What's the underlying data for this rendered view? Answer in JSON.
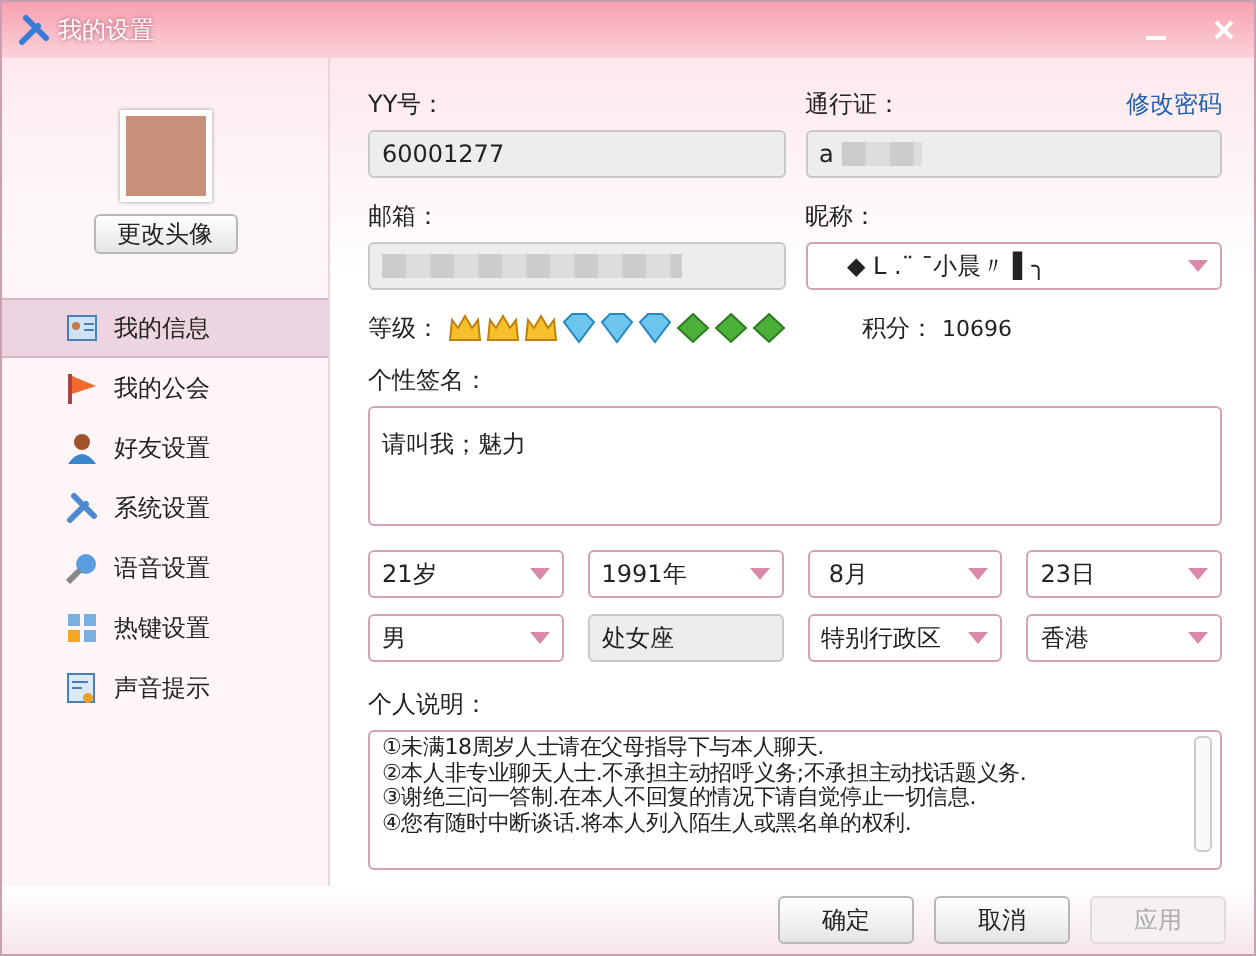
{
  "window": {
    "title": "我的设置"
  },
  "sidebar": {
    "change_avatar_button": "更改头像",
    "items": [
      {
        "label": "我的信息",
        "selected": true
      },
      {
        "label": "我的公会",
        "selected": false
      },
      {
        "label": "好友设置",
        "selected": false
      },
      {
        "label": "系统设置",
        "selected": false
      },
      {
        "label": "语音设置",
        "selected": false
      },
      {
        "label": "热键设置",
        "selected": false
      },
      {
        "label": "声音提示",
        "selected": false
      }
    ]
  },
  "account": {
    "yy_label": "YY号：",
    "yy_value": "60001277",
    "pass_label": "通行证：",
    "change_password_link": "修改密码",
    "pass_value": "a",
    "email_label": "邮箱：",
    "nickname_label": "昵称：",
    "nickname_value": "◆ L .¨ ¯小晨〃 ▌╮"
  },
  "level": {
    "label": "等级：",
    "badges": [
      {
        "kind": "crown"
      },
      {
        "kind": "crown"
      },
      {
        "kind": "crown"
      },
      {
        "kind": "diamond"
      },
      {
        "kind": "diamond"
      },
      {
        "kind": "diamond"
      },
      {
        "kind": "leaf"
      },
      {
        "kind": "leaf"
      },
      {
        "kind": "leaf"
      }
    ],
    "points_label": "积分：",
    "points_value": "10696"
  },
  "signature": {
    "label": "个性签名：",
    "value": "请叫我；魅力"
  },
  "profile_fields": [
    {
      "kind": "select",
      "value": "21岁"
    },
    {
      "kind": "select",
      "value": "1991年"
    },
    {
      "kind": "select",
      "value": " 8月"
    },
    {
      "kind": "select",
      "value": "23日"
    },
    {
      "kind": "select",
      "value": "男"
    },
    {
      "kind": "static",
      "value": "处女座"
    },
    {
      "kind": "select",
      "value": "特别行政区"
    },
    {
      "kind": "select",
      "value": "香港"
    }
  ],
  "description": {
    "label": "个人说明：",
    "lines": [
      "①未满18周岁人士请在父母指导下与本人聊天.",
      "②本人非专业聊天人士.不承担主动招呼义务;不承担主动找话题义务.",
      "③谢绝三问一答制.在本人不回复的情况下请自觉停止一切信息.",
      "④您有随时中断谈话.将本人列入陌生人或黑名单的权利."
    ]
  },
  "buttons": [
    {
      "label": "确定",
      "disabled": false
    },
    {
      "label": "取消",
      "disabled": false
    },
    {
      "label": "应用",
      "disabled": true
    }
  ]
}
